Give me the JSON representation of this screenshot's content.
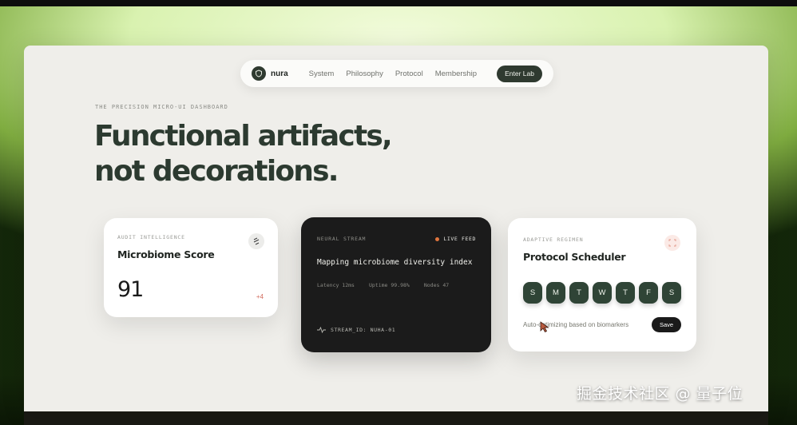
{
  "nav": {
    "brand": "nura",
    "links": [
      "System",
      "Philosophy",
      "Protocol",
      "Membership"
    ],
    "cta": "Enter Lab"
  },
  "hero": {
    "eyebrow": "THE PRECISION MICRO-UI DASHBOARD",
    "headline_line1": "Functional artifacts,",
    "headline_line2": "not decorations."
  },
  "card_score": {
    "label": "AUDIT INTELLIGENCE",
    "title": "Microbiome Score",
    "value": "91",
    "delta": "+4"
  },
  "card_stream": {
    "label": "NEURAL STREAM",
    "status": "LIVE FEED",
    "message": "Mapping microbiome diversity index",
    "stats": [
      "Latency 12ms",
      "Uptime 99.98%",
      "Nodes 47"
    ],
    "stream_id": "STREAM_ID: NUHA-01"
  },
  "card_scheduler": {
    "label": "ADAPTIVE REGIMEN",
    "title": "Protocol Scheduler",
    "days": [
      "S",
      "M",
      "T",
      "W",
      "T",
      "F",
      "S"
    ],
    "note": "Auto-optimizing based on biomarkers",
    "save": "Save"
  },
  "watermark": "掘金技术社区 @ 量子位",
  "colors": {
    "accent_dark": "#2f3a30",
    "live_dot": "#e0753e",
    "delta": "#d26b5c",
    "day_button": "#2f4436"
  }
}
